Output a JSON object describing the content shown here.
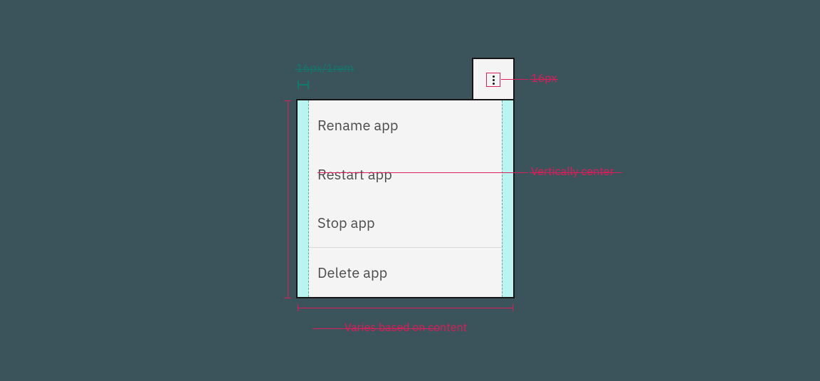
{
  "annotations": {
    "padding_label": "16px/1rem",
    "icon_size_label": "16px",
    "vertical_center_label": "Vertically center",
    "width_label": "Varies based on content"
  },
  "overflow_trigger": {
    "icon_name": "overflow-menu-vertical"
  },
  "menu": {
    "items": [
      {
        "label": "Rename app"
      },
      {
        "label": "Restart app"
      },
      {
        "label": "Stop app"
      },
      {
        "label": "Delete app"
      }
    ]
  },
  "colors": {
    "background": "#3b535a",
    "panel_bg": "#f4f4f4",
    "panel_border": "#161616",
    "padding_highlight": "#b8f4f0",
    "annotation_teal": "#12786b",
    "annotation_pink": "#d91e5b",
    "item_text": "#4a4a4a",
    "divider": "#d8d8d8"
  }
}
